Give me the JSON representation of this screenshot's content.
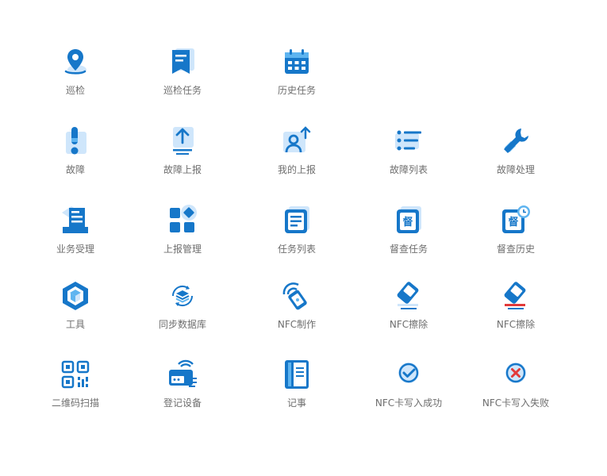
{
  "colors": {
    "primary": "#1677c9",
    "light": "#cfe6fb",
    "mid": "#5eb4f0",
    "danger": "#e23a3a",
    "label": "#6e6e6e"
  },
  "tiles": [
    {
      "id": "inspection",
      "label": "巡检",
      "icon": "map-pin-icon"
    },
    {
      "id": "inspection-task",
      "label": "巡检任务",
      "icon": "bookmark-list-icon"
    },
    {
      "id": "history-task",
      "label": "历史任务",
      "icon": "calendar-icon"
    },
    {
      "id": "fault",
      "label": "故障",
      "icon": "exclamation-icon"
    },
    {
      "id": "fault-report",
      "label": "故障上报",
      "icon": "upload-icon"
    },
    {
      "id": "my-report",
      "label": "我的上报",
      "icon": "user-upload-icon"
    },
    {
      "id": "fault-list",
      "label": "故障列表",
      "icon": "list-icon"
    },
    {
      "id": "fault-handle",
      "label": "故障处理",
      "icon": "wrench-icon"
    },
    {
      "id": "business-accept",
      "label": "业务受理",
      "icon": "document-tray-icon"
    },
    {
      "id": "report-manage",
      "label": "上报管理",
      "icon": "grid-apps-icon"
    },
    {
      "id": "task-list",
      "label": "任务列表",
      "icon": "doc-list-icon"
    },
    {
      "id": "supervise-task",
      "label": "督查任务",
      "icon": "supervise-icon"
    },
    {
      "id": "supervise-history",
      "label": "督查历史",
      "icon": "supervise-clock-icon"
    },
    {
      "id": "tools",
      "label": "工具",
      "icon": "cube-icon"
    },
    {
      "id": "sync-db",
      "label": "同步数据库",
      "icon": "sync-database-icon"
    },
    {
      "id": "nfc-make",
      "label": "NFC制作",
      "icon": "nfc-card-icon"
    },
    {
      "id": "nfc-erase-1",
      "label": "NFC擦除",
      "icon": "eraser-icon"
    },
    {
      "id": "nfc-erase-2",
      "label": "NFC擦除",
      "icon": "eraser-red-icon"
    },
    {
      "id": "qr-scan",
      "label": "二维码扫描",
      "icon": "qr-code-icon"
    },
    {
      "id": "register-device",
      "label": "登记设备",
      "icon": "register-device-icon"
    },
    {
      "id": "notes",
      "label": "记事",
      "icon": "notebook-icon"
    },
    {
      "id": "nfc-write-success",
      "label": "NFC卡写入成功",
      "icon": "check-circle-icon"
    },
    {
      "id": "nfc-write-fail",
      "label": "NFC卡写入失败",
      "icon": "x-circle-icon"
    }
  ]
}
